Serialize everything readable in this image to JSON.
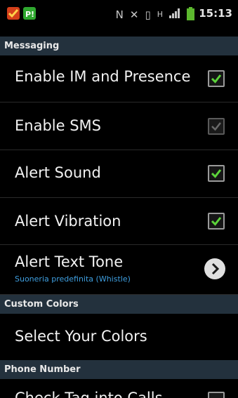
{
  "status_bar": {
    "time": "15:13",
    "icons": [
      "nfc-icon",
      "mute-icon",
      "vibrate-icon",
      "data-h-icon",
      "signal-icon",
      "battery-icon"
    ]
  },
  "sections": {
    "messaging": "Messaging",
    "custom_colors": "Custom Colors",
    "phone_number": "Phone Number"
  },
  "settings": {
    "enable_im": {
      "label": "Enable IM and Presence",
      "checked": true
    },
    "enable_sms": {
      "label": "Enable SMS",
      "checked": true,
      "disabled": true
    },
    "alert_sound": {
      "label": "Alert Sound",
      "checked": true
    },
    "alert_vibration": {
      "label": "Alert Vibration",
      "checked": true
    },
    "alert_text_tone": {
      "label": "Alert Text Tone",
      "value": "Suoneria predefinita (Whistle)"
    },
    "select_colors": {
      "label": "Select Your Colors"
    },
    "partial_item": {
      "label": "Check Tag into Calls"
    }
  },
  "colors": {
    "section_bg": "#23313d",
    "check_green": "#5cd33a",
    "subtitle_blue": "#3f9fe0"
  }
}
